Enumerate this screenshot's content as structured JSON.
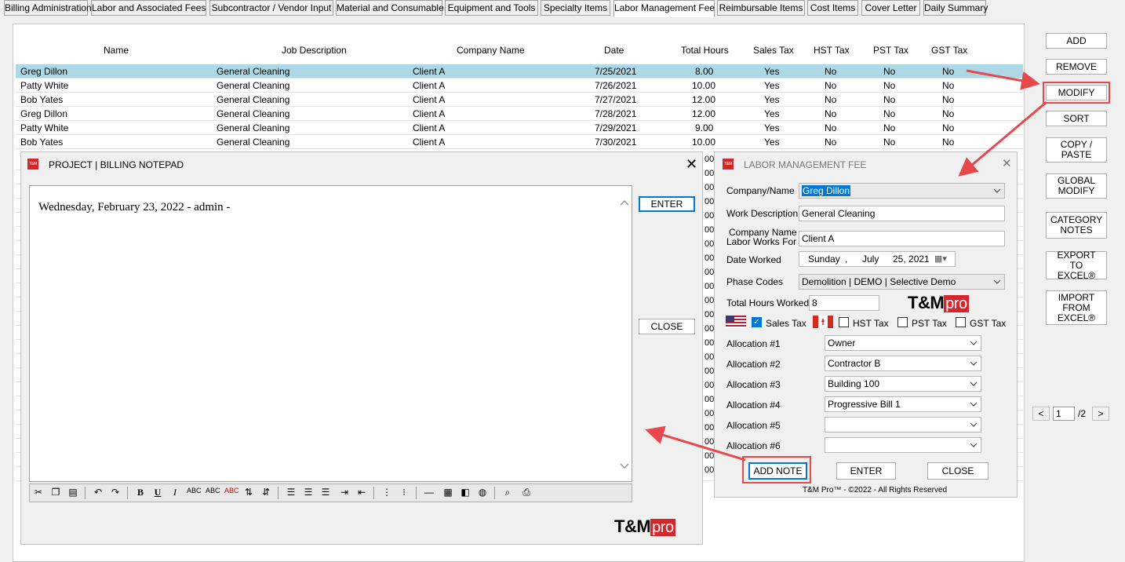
{
  "tabs": [
    {
      "label": "Billing Administration"
    },
    {
      "label": "Labor and Associated Fees"
    },
    {
      "label": "Subcontractor / Vendor Input"
    },
    {
      "label": "Material and Consumable"
    },
    {
      "label": "Equipment and Tools"
    },
    {
      "label": "Specialty Items"
    },
    {
      "label": "Labor Management Fee"
    },
    {
      "label": "Reimbursable Items"
    },
    {
      "label": "Cost Items"
    },
    {
      "label": "Cover Letter"
    },
    {
      "label": "Daily Summary"
    }
  ],
  "grid": {
    "headers": [
      "Name",
      "Job Description",
      "Company Name",
      "Date",
      "Total Hours",
      "Sales Tax",
      "HST Tax",
      "PST Tax",
      "GST Tax"
    ],
    "rows": [
      [
        "Greg Dillon",
        "General Cleaning",
        "Client A",
        "7/25/2021",
        "8.00",
        "Yes",
        "No",
        "No",
        "No"
      ],
      [
        "Patty White",
        "General Cleaning",
        "Client A",
        "7/26/2021",
        "10.00",
        "Yes",
        "No",
        "No",
        "No"
      ],
      [
        "Bob Yates",
        "General Cleaning",
        "Client A",
        "7/27/2021",
        "12.00",
        "Yes",
        "No",
        "No",
        "No"
      ],
      [
        "Greg Dillon",
        "General Cleaning",
        "Client A",
        "7/28/2021",
        "12.00",
        "Yes",
        "No",
        "No",
        "No"
      ],
      [
        "Patty White",
        "General Cleaning",
        "Client A",
        "7/29/2021",
        "9.00",
        "Yes",
        "No",
        "No",
        "No"
      ],
      [
        "Bob Yates",
        "General Cleaning",
        "Client A",
        "7/30/2021",
        "10.00",
        "Yes",
        "No",
        "No",
        "No"
      ]
    ],
    "partial_cells": [
      "00",
      "00",
      "00",
      "00",
      "00",
      "00",
      "00",
      "00",
      "00",
      "00",
      "00",
      "00",
      "00",
      "00",
      "00",
      "00",
      "00",
      "00",
      "00",
      "00",
      "00",
      "00",
      "00"
    ]
  },
  "actions": {
    "add": "ADD",
    "remove": "REMOVE",
    "modify": "MODIFY",
    "sort": "SORT",
    "copy_paste": "COPY / PASTE",
    "global_modify": "GLOBAL MODIFY",
    "category_notes": "CATEGORY NOTES",
    "export_excel": "EXPORT TO EXCEL®",
    "import_excel": "IMPORT FROM EXCEL®"
  },
  "pager": {
    "prev": "<",
    "page": "1",
    "total": "/2",
    "next": ">"
  },
  "notepad": {
    "title": "PROJECT | BILLING NOTEPAD",
    "close_x": "✕",
    "text": "Wednesday, February 23, 2022 - admin -",
    "enter": "ENTER",
    "close": "CLOSE"
  },
  "labor": {
    "title": "LABOR MANAGEMENT FEE",
    "close_x": "✕",
    "company_name_label": "Company/Name",
    "company_name_value": "Greg Dillon",
    "work_desc_label": "Work Description",
    "work_desc_value": "General Cleaning",
    "company_works_for_label1": "Company Name",
    "company_works_for_label2": "Labor Works For",
    "company_works_for_value": "Client A",
    "date_label": "Date Worked",
    "date_day": "Sunday",
    "date_sep": ",",
    "date_month": "July",
    "date_rest": "25, 2021",
    "phase_label": "Phase Codes",
    "phase_value": "Demolition | DEMO | Selective Demo",
    "hours_label": "Total Hours Worked",
    "hours_value": "8",
    "sales_tax": "Sales Tax",
    "hst_tax": "HST Tax",
    "pst_tax": "PST Tax",
    "gst_tax": "GST Tax",
    "allocations": [
      {
        "label": "Allocation #1",
        "value": "Owner"
      },
      {
        "label": "Allocation #2",
        "value": "Contractor B"
      },
      {
        "label": "Allocation #3",
        "value": "Building 100"
      },
      {
        "label": "Allocation #4",
        "value": "Progressive Bill 1"
      },
      {
        "label": "Allocation #5",
        "value": ""
      },
      {
        "label": "Allocation #6",
        "value": ""
      }
    ],
    "add_note": "ADD NOTE",
    "enter": "ENTER",
    "close": "CLOSE",
    "footer": "T&M Pro™ - ©2022 - All Rights Reserved"
  },
  "logo": {
    "tm": "T&M",
    "pro": "pro",
    "icon_text": "T&M"
  },
  "colors": {
    "selection": "#add8e6",
    "accent": "#0078d7",
    "brand": "#d7262b",
    "highlight": "#e8484b"
  }
}
